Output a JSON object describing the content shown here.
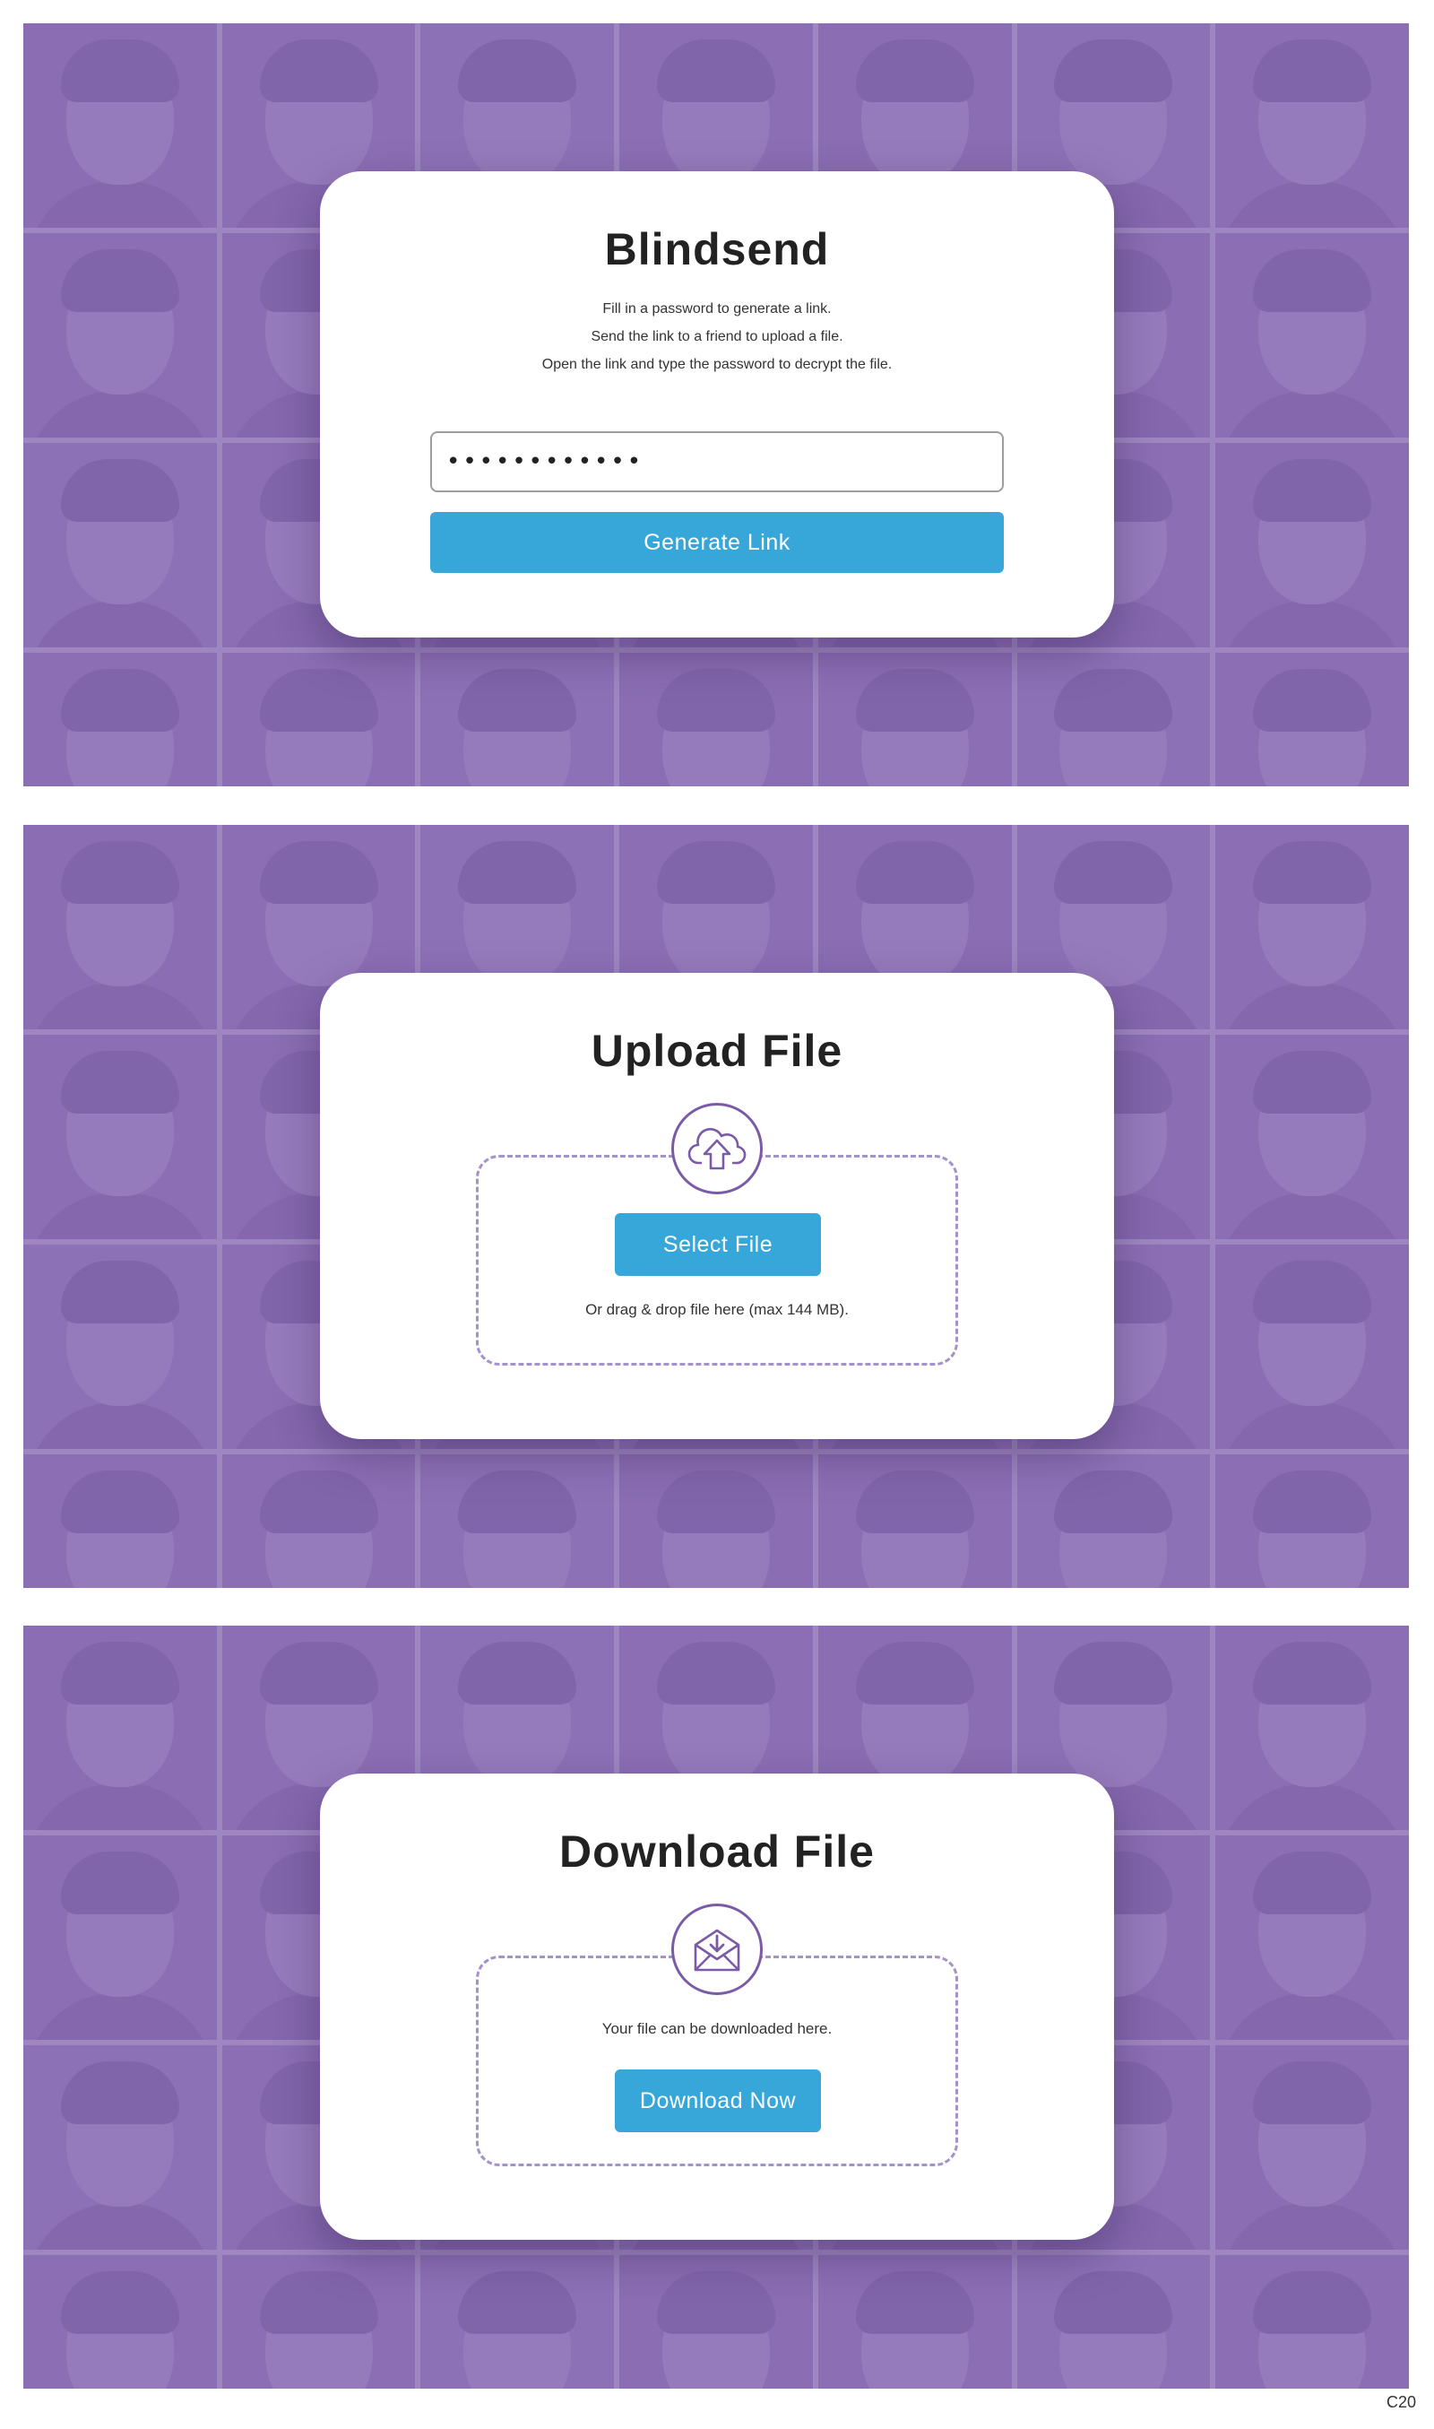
{
  "screens": {
    "generate": {
      "title": "Blindsend",
      "description": [
        "Fill in a password to generate a link.",
        "Send the link to a friend to upload a file.",
        "Open the link and type the password to decrypt the file."
      ],
      "password_value": "••••••••••••",
      "button_label": "Generate Link"
    },
    "upload": {
      "title": "Upload File",
      "icon": "cloud-upload-icon",
      "button_label": "Select File",
      "hint": "Or drag & drop file here (max 144 MB)."
    },
    "download": {
      "title": "Download File",
      "icon": "envelope-download-icon",
      "message": "Your file can be downloaded here.",
      "button_label": "Download Now"
    }
  },
  "page_code": "C20",
  "colors": {
    "background_overlay": "#8f72b6",
    "button": "#37a6d8",
    "icon_stroke": "#7b5aa8",
    "dashed_border": "#a592c8"
  }
}
